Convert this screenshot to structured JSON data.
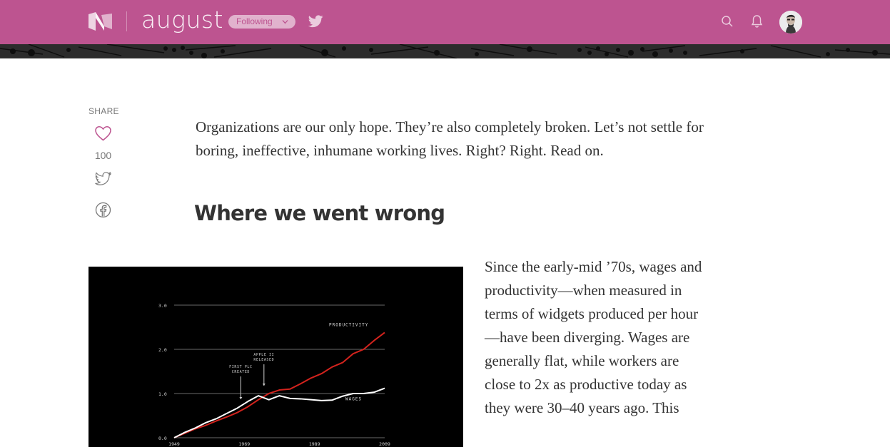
{
  "header": {
    "publication_name": "august",
    "follow_label": "Following",
    "colors": {
      "brand": "#bd5490",
      "banner": "#2c2c2c"
    },
    "icons": [
      "medium-logo-icon",
      "twitter-icon",
      "search-icon",
      "bell-icon",
      "avatar"
    ]
  },
  "share": {
    "label": "SHARE",
    "like_count": "100",
    "icons": [
      "heart-icon",
      "twitter-icon",
      "facebook-icon"
    ]
  },
  "article": {
    "intro": "Organizations are our only hope. They’re also completely broken. Let’s not settle for boring, ineffective, inhumane working lives. Right? Right. Read on.",
    "heading": "Where we went wrong",
    "body": "Since the early-mid ’70s, wages and productivity—when measured in terms of widgets produced per hour—have been diverging. Wages are generally flat, while workers are close to 2x as productive today as they were 30–40 years ago. This"
  },
  "chart_data": {
    "type": "line",
    "x": [
      1949,
      1952,
      1955,
      1958,
      1961,
      1964,
      1967,
      1970,
      1973,
      1976,
      1979,
      1982,
      1985,
      1988,
      1991,
      1994,
      1997,
      2000,
      2003,
      2006,
      2009
    ],
    "series": [
      {
        "name": "PRODUCTIVITY",
        "color": "#d3231d",
        "values": [
          0.0,
          0.1,
          0.2,
          0.28,
          0.38,
          0.47,
          0.57,
          0.7,
          0.86,
          1.0,
          1.08,
          1.1,
          1.22,
          1.35,
          1.45,
          1.6,
          1.7,
          1.9,
          2.0,
          2.2,
          2.38
        ]
      },
      {
        "name": "WAGES",
        "color": "#ffffff",
        "values": [
          0.0,
          0.12,
          0.22,
          0.34,
          0.43,
          0.55,
          0.67,
          0.82,
          0.95,
          0.86,
          0.95,
          0.89,
          0.88,
          0.86,
          0.84,
          0.85,
          0.94,
          1.0,
          1.0,
          1.03,
          1.12
        ]
      }
    ],
    "xticks": [
      "1949",
      "1969",
      "1989",
      "2009"
    ],
    "yticks": [
      "0.0",
      "1.0",
      "2.0",
      "3.0"
    ],
    "ylim": [
      0,
      3.0
    ],
    "xlim": [
      1949,
      2009
    ],
    "annotations": [
      {
        "text_lines": [
          "FIRST PLC",
          "CREATED"
        ],
        "x": 1968
      },
      {
        "text_lines": [
          "APPLE II",
          "RELEASED"
        ],
        "x": 1975
      }
    ],
    "grid": true
  }
}
